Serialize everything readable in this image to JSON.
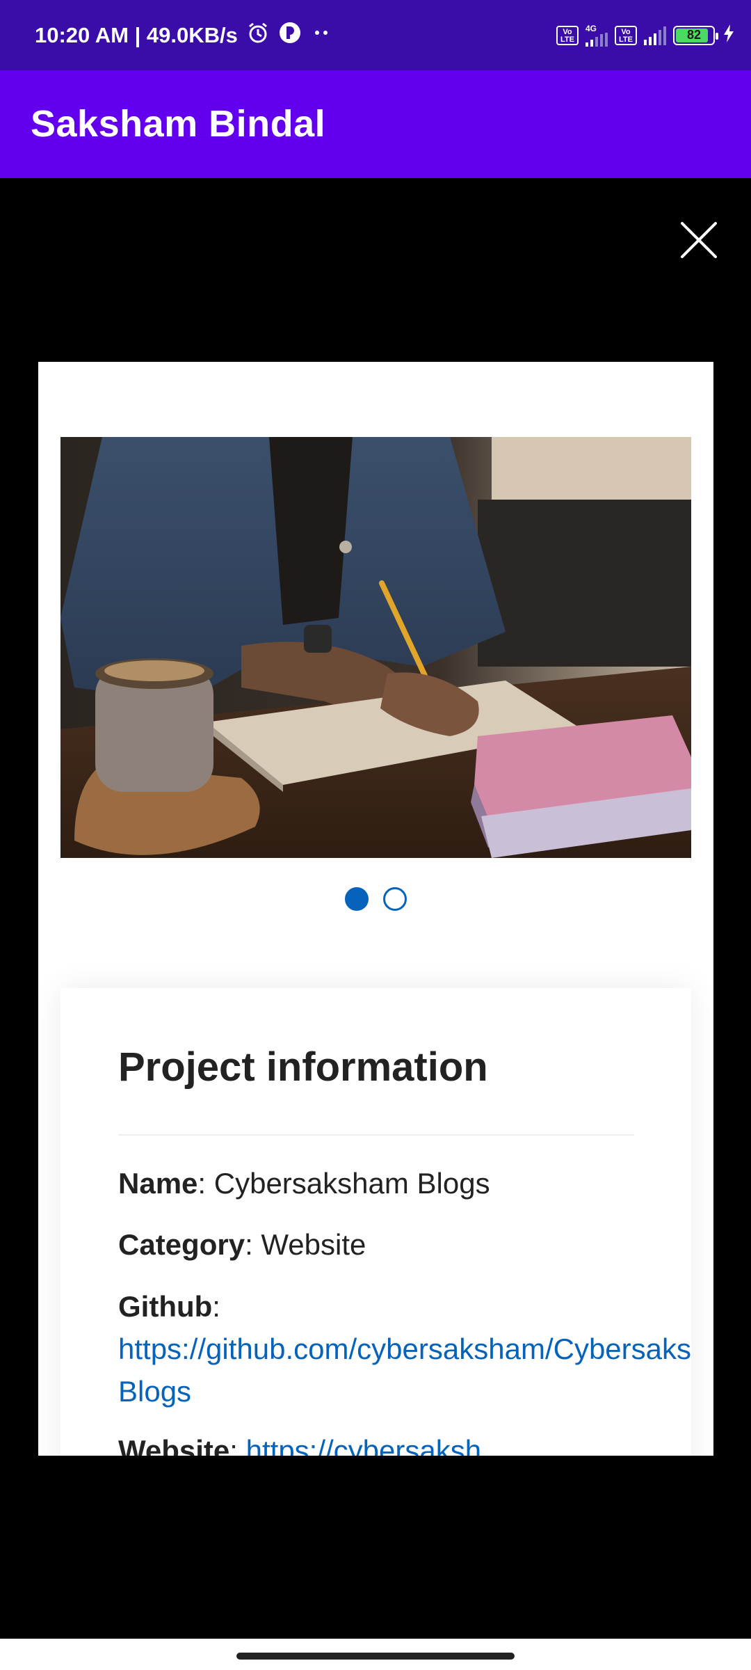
{
  "status_bar": {
    "time_speed": "10:20 AM | 49.0KB/s",
    "network_label": "4G",
    "volte_label": "Vo LTE",
    "battery_level": "82"
  },
  "app_bar": {
    "title": "Saksham Bindal"
  },
  "lightbox": {
    "slide_count": 2,
    "active_slide": 1
  },
  "project_info": {
    "title": "Project information",
    "name_label": "Name",
    "name_value": "Cybersaksham Blogs",
    "category_label": "Category",
    "category_value": "Website",
    "github_label": "Github",
    "github_url_line1": "https://github.com/cybersaksham/Cybersaks",
    "github_url_line2": "Blogs",
    "website_label": "Website",
    "website_value": "https://cybersaksh"
  },
  "colors": {
    "status_bar": "#3a0ca8",
    "app_bar": "#6200ee",
    "accent": "#0563bb"
  }
}
